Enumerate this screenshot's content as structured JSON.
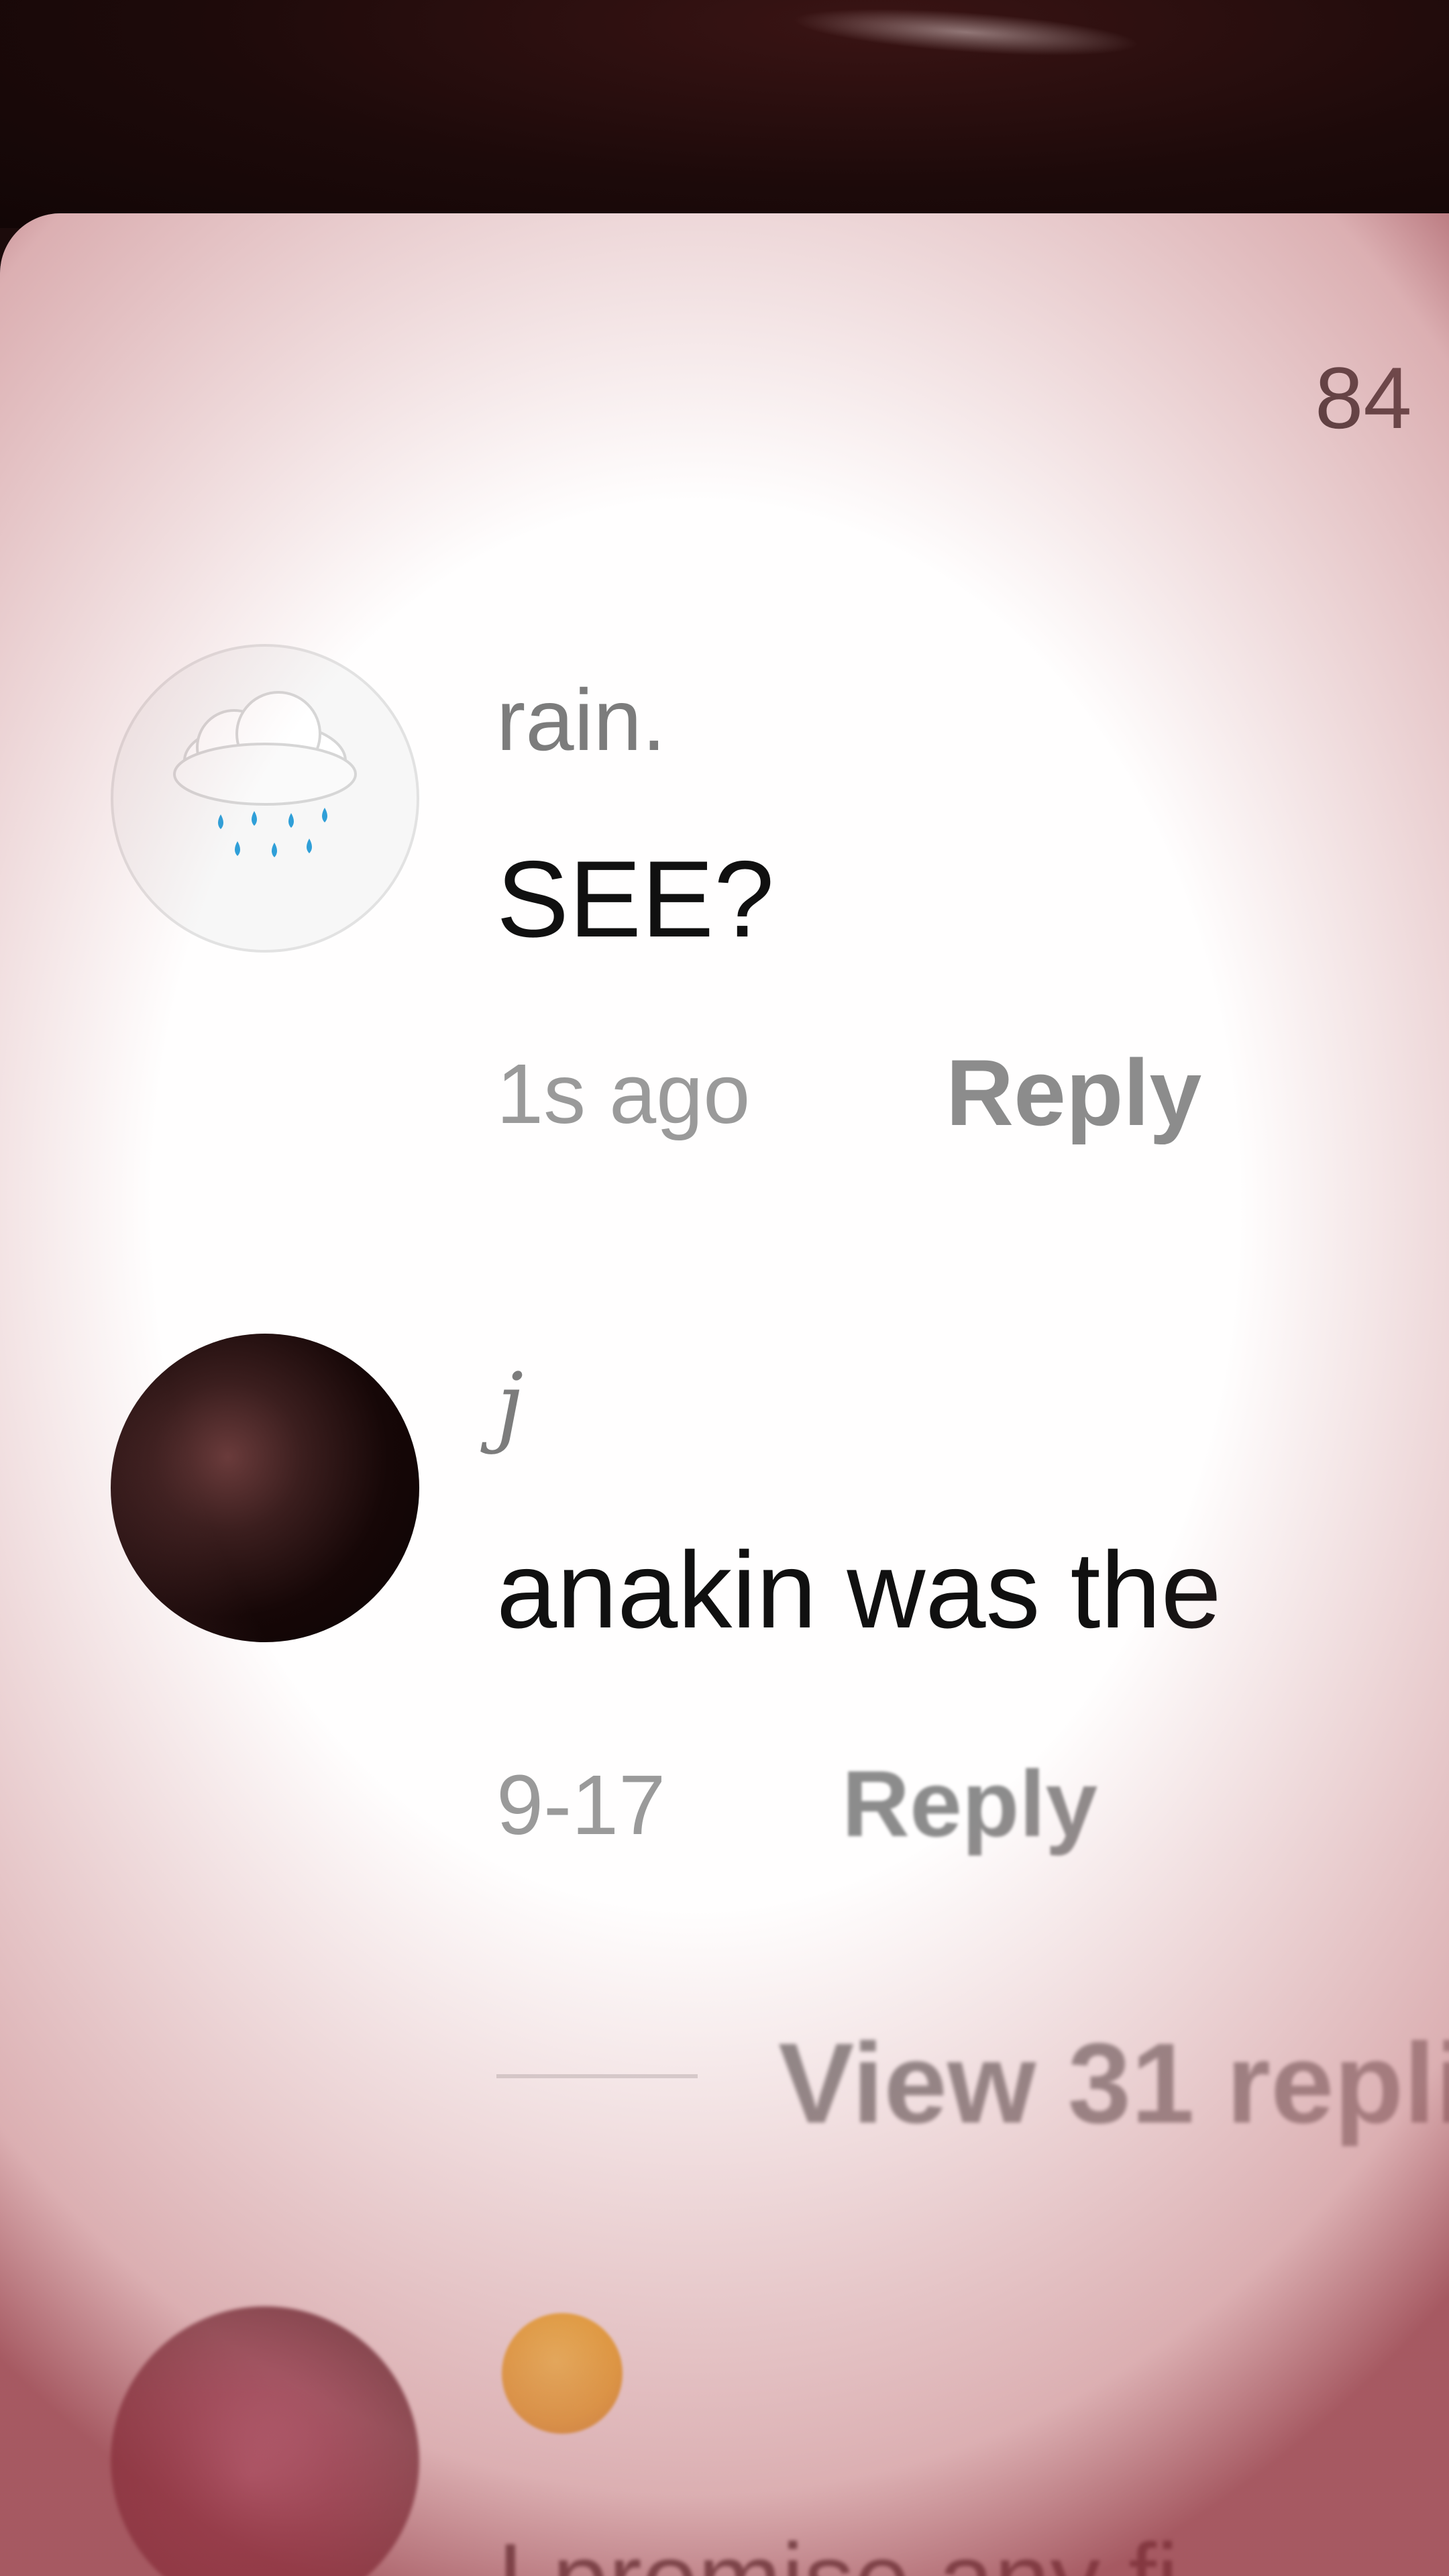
{
  "header": {
    "comment_count": "84"
  },
  "comments": [
    {
      "username": "rain.",
      "avatar": "rain-cloud-emoji",
      "text": "SEE?",
      "time": "1s ago",
      "reply_label": "Reply"
    },
    {
      "username": "j",
      "avatar": "user-photo",
      "text": "anakin was the",
      "time": "9-17",
      "reply_label": "Reply",
      "view_replies": "View 31 repli"
    },
    {
      "avatar": "user-photo",
      "emoji": "crying-face",
      "text": "I promise any fi"
    }
  ],
  "colors": {
    "sheet_bg": "#fffefe",
    "vignette": "#963c46",
    "username": "#7c7c7c",
    "meta": "#9a9a9a"
  }
}
